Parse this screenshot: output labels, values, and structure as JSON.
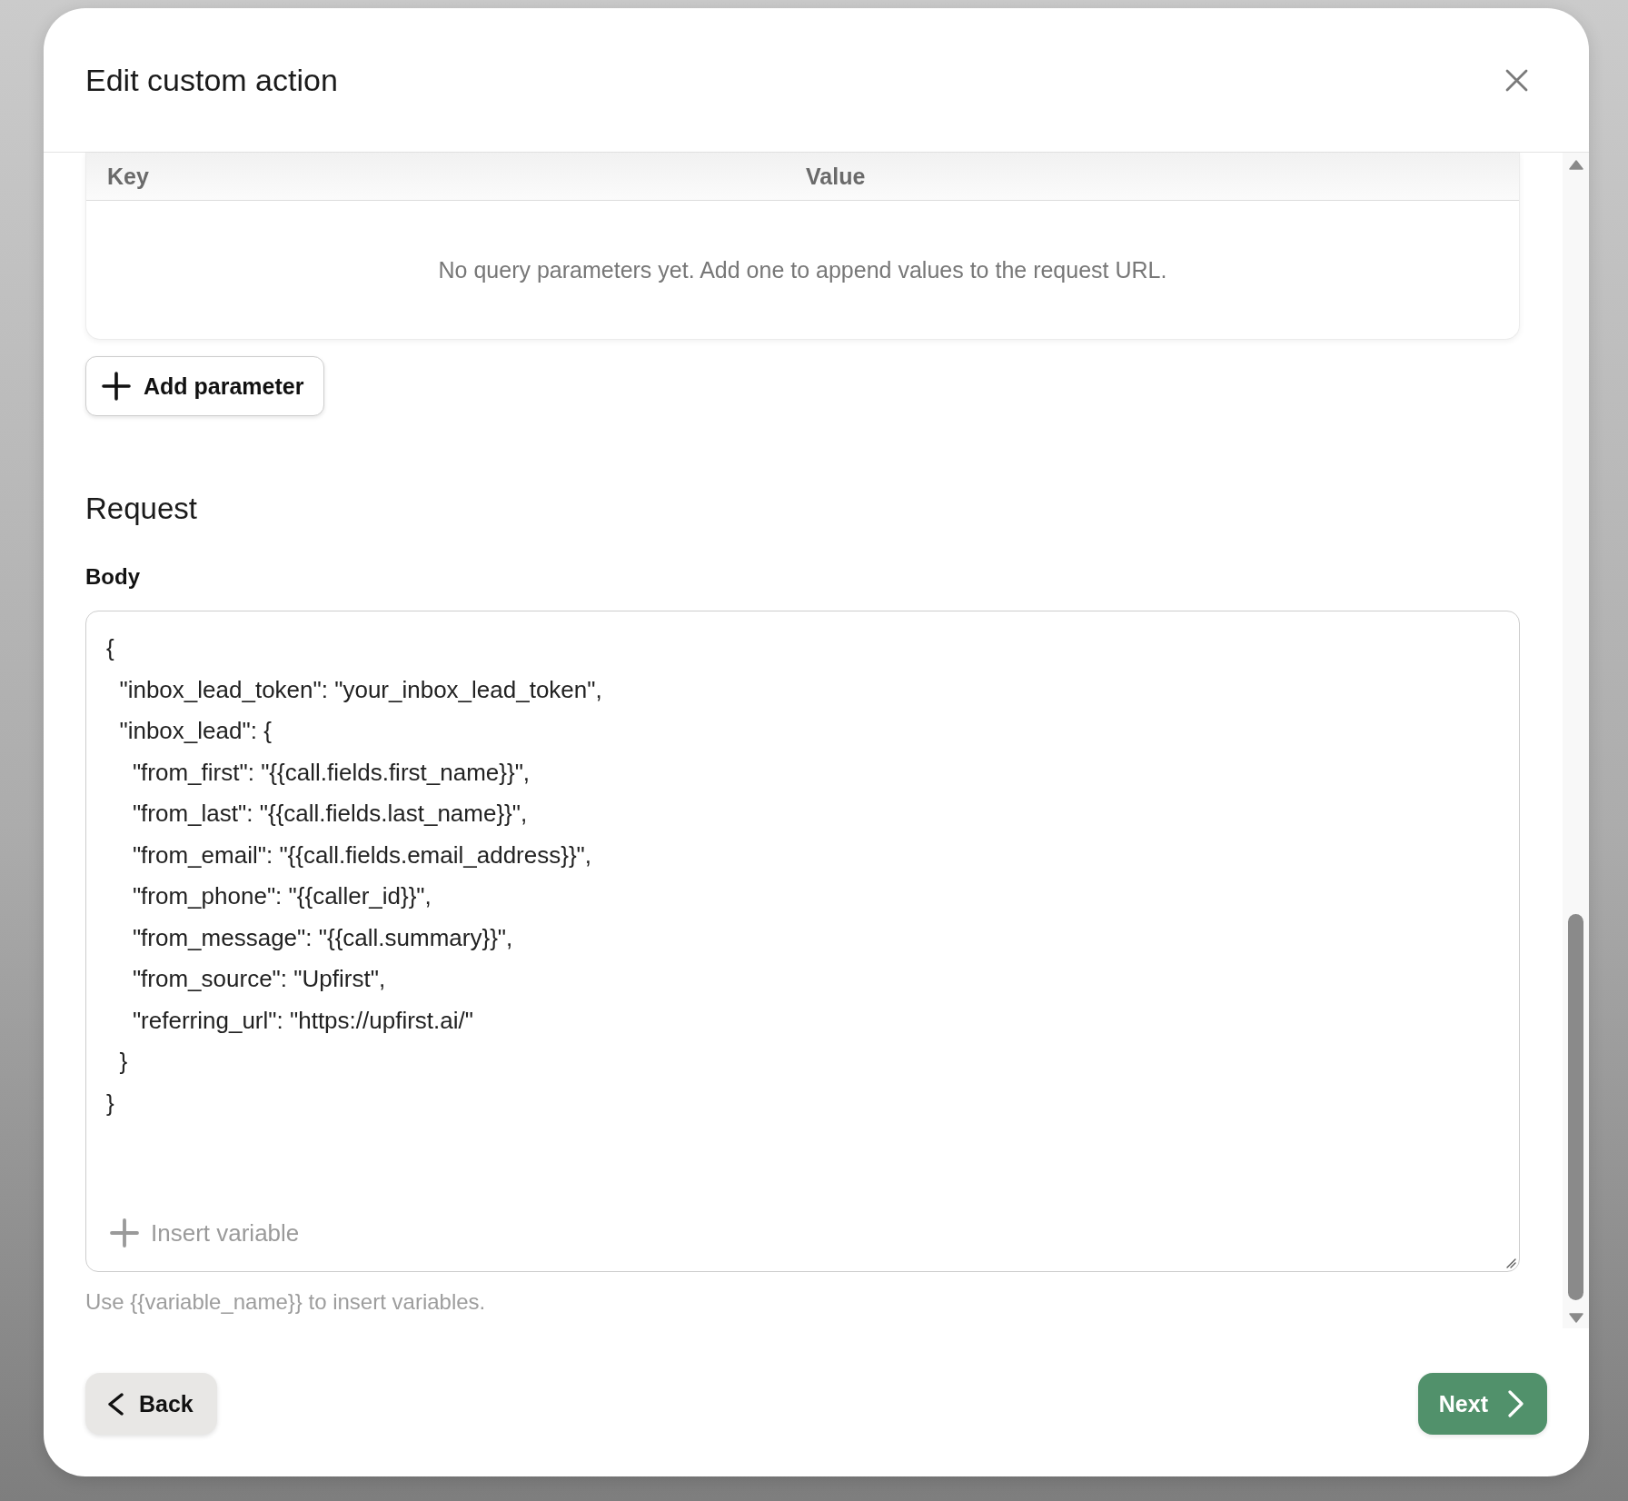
{
  "dialog": {
    "title": "Edit custom action"
  },
  "query_parameters": {
    "columns": [
      "Key",
      "Value"
    ],
    "empty_message": "No query parameters yet. Add one to append values to the request URL.",
    "add_button": "Add parameter"
  },
  "request": {
    "heading": "Request",
    "body_label": "Body",
    "body_value": "{\n  \"inbox_lead_token\": \"your_inbox_lead_token\",\n  \"inbox_lead\": {\n    \"from_first\": \"{{call.fields.first_name}}\",\n    \"from_last\": \"{{call.fields.last_name}}\",\n    \"from_email\": \"{{call.fields.email_address}}\",\n    \"from_phone\": \"{{caller_id}}\",\n    \"from_message\": \"{{call.summary}}\",\n    \"from_source\": \"Upfirst\",\n    \"referring_url\": \"https://upfirst.ai/\"\n  }\n}",
    "insert_variable": "Insert variable",
    "hint": "Use {{variable_name}} to insert variables."
  },
  "footer": {
    "back_button": "Back",
    "next_button": "Next"
  }
}
